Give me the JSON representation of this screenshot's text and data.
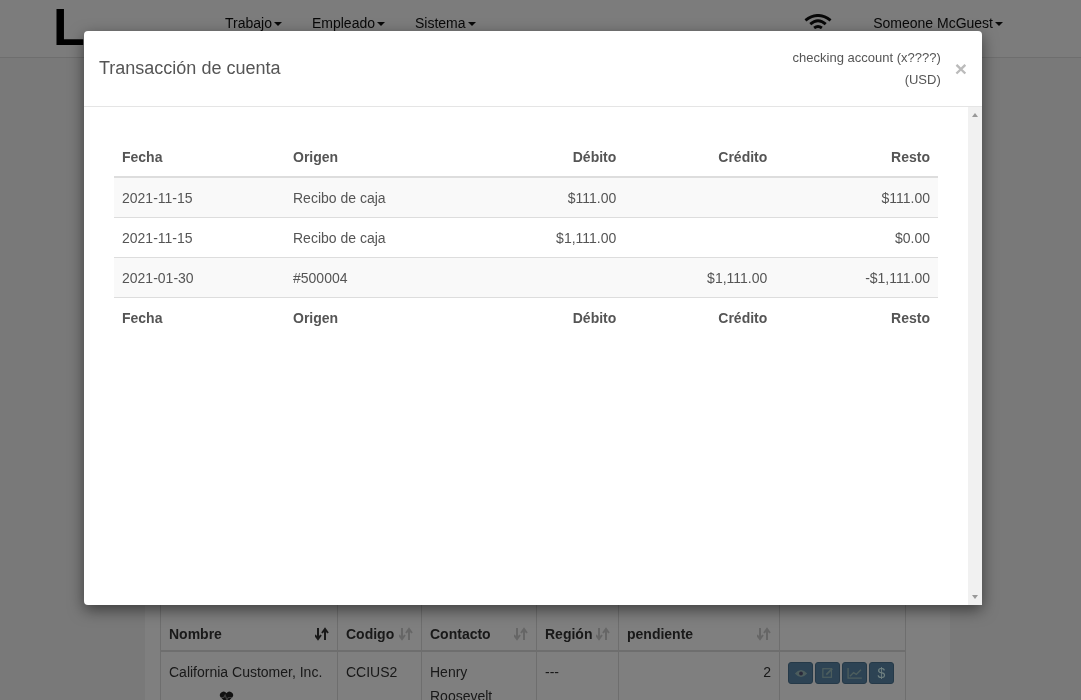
{
  "navbar": {
    "logo": "L",
    "menus": [
      {
        "label": "Trabajo"
      },
      {
        "label": "Empleado"
      },
      {
        "label": "Sistema"
      }
    ],
    "user": "Someone McGuest"
  },
  "customers_table": {
    "columns": [
      {
        "label": "Nombre",
        "sorted": true
      },
      {
        "label": "Codigo",
        "sorted": false
      },
      {
        "label": "Contacto",
        "sorted": false
      },
      {
        "label": "Región",
        "sorted": false
      },
      {
        "label": "pendiente",
        "sorted": false
      },
      {}
    ],
    "rows": [
      {
        "nombre": "California Customer, Inc.",
        "codigo": "CCIUS2",
        "contacto": "Henry Roosevelt",
        "region": "---",
        "pendiente": "2",
        "dollar": "$"
      }
    ]
  },
  "modal": {
    "title": "Transacción de cuenta",
    "account": "checking account (x????)",
    "currency": "(USD)",
    "close": "×",
    "columns": [
      "Fecha",
      "Origen",
      "Débito",
      "Crédito",
      "Resto"
    ],
    "rows": [
      {
        "fecha": "2021-11-15",
        "origen": "Recibo de caja",
        "debito": "$111.00",
        "resto": "$111.00"
      },
      {
        "fecha": "2021-11-15",
        "origen": "Recibo de caja",
        "debito": "$1,111.00",
        "resto": "$0.00"
      },
      {
        "fecha": "2021-01-30",
        "origen": "#500004",
        "credito": "$1,111.00",
        "resto": "-$1,111.00"
      }
    ],
    "footer": [
      "Fecha",
      "Origen",
      "Débito",
      "Crédito",
      "Resto"
    ]
  }
}
